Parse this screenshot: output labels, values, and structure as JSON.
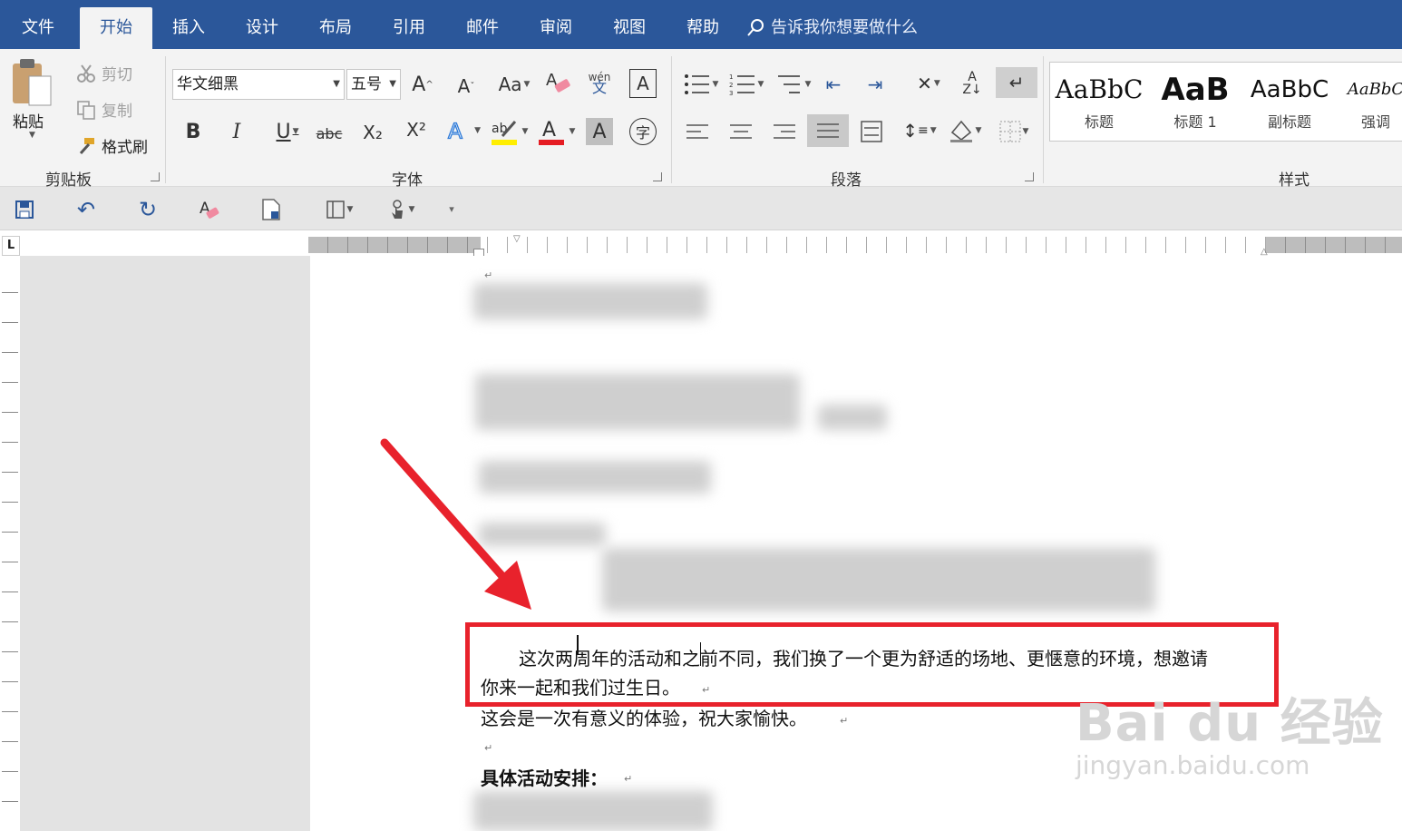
{
  "tabs": [
    {
      "label": "文件",
      "active": false
    },
    {
      "label": "开始",
      "active": true
    },
    {
      "label": "插入",
      "active": false
    },
    {
      "label": "设计",
      "active": false
    },
    {
      "label": "布局",
      "active": false
    },
    {
      "label": "引用",
      "active": false
    },
    {
      "label": "邮件",
      "active": false
    },
    {
      "label": "审阅",
      "active": false
    },
    {
      "label": "视图",
      "active": false
    },
    {
      "label": "帮助",
      "active": false
    }
  ],
  "tell_me": "告诉我你想要做什么",
  "clipboard": {
    "group_label": "剪贴板",
    "paste": "粘贴",
    "cut": "剪切",
    "copy": "复制",
    "format_painter": "格式刷"
  },
  "font": {
    "group_label": "字体",
    "font_name": "华文细黑",
    "font_size": "五号",
    "change_case": "Aa",
    "bold": "B",
    "italic": "I",
    "underline": "U",
    "strike": "abc",
    "subscript": "X₂",
    "superscript": "X²",
    "pinyin_top": "wén",
    "pinyin_bottom": "文",
    "border_char": "A",
    "shading_char": "A",
    "enclose_char": "字"
  },
  "paragraph": {
    "group_label": "段落"
  },
  "styles": {
    "group_label": "样式",
    "items": [
      {
        "sample": "AaBbC",
        "name": "标题"
      },
      {
        "sample": "AaB",
        "name": "标题 1"
      },
      {
        "sample": "AaBbC",
        "name": "副标题"
      },
      {
        "sample": "AaBbC",
        "name": "强调"
      }
    ]
  },
  "ruler_corner": "L",
  "document": {
    "highlighted_line1": "这次两周年的活动和之前不同，我们换了一个更为舒适的场地、更惬意的环境，想邀请",
    "highlighted_line2": "你来一起和我们过生日。",
    "line3": "这会是一次有意义的体验，祝大家愉快。",
    "heading": "具体活动安排："
  },
  "watermark": {
    "main": "Bai du 经验",
    "sub": "jingyan.baidu.com"
  },
  "colors": {
    "accent": "#2b579a",
    "annotation": "#e8222c",
    "ribbon_bg": "#f3f3f3"
  }
}
